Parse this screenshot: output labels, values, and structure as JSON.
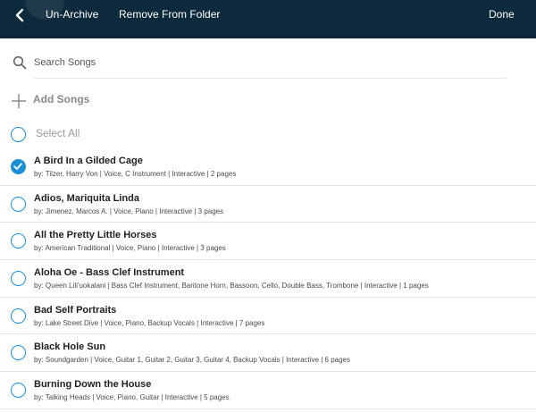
{
  "header": {
    "unarchive_label": "Un-Archive",
    "remove_label": "Remove From Folder",
    "done_label": "Done",
    "bg_color": "#0c2a3b"
  },
  "search": {
    "placeholder": "Search Songs",
    "value": ""
  },
  "add_songs_label": "Add Songs",
  "select_all_label": "Select All",
  "accent_color": "#1a8fd6",
  "songs": [
    {
      "title": "A Bird In a Gilded Cage",
      "meta": "by: Tilzer, Harry Von | Voice, C Instrument | Interactive | 2 pages",
      "checked": true
    },
    {
      "title": "Adios, Mariquita Linda",
      "meta": "by: Jimenez, Marcos A. | Voice, Piano | Interactive | 3 pages",
      "checked": false
    },
    {
      "title": "All the Pretty Little Horses",
      "meta": "by: American Traditional | Voice, Piano | Interactive | 3 pages",
      "checked": false
    },
    {
      "title": "Aloha Oe - Bass Clef Instrument",
      "meta": "by: Queen Lili'uokalani | Bass Clef Instrument, Baritone Horn, Bassoon, Cello, Double Bass, Trombone | Interactive | 1 pages",
      "checked": false
    },
    {
      "title": "Bad Self Portraits",
      "meta": "by: Lake Street Dive | Voice, Piano, Backup Vocals | Interactive | 7 pages",
      "checked": false
    },
    {
      "title": "Black Hole Sun",
      "meta": "by: Soundgarden | Voice, Guitar 1, Guitar 2, Guitar 3, Guitar 4, Backup Vocals | Interactive | 6 pages",
      "checked": false
    },
    {
      "title": "Burning Down the House",
      "meta": "by: Talking Heads | Voice, Piano, Guitar | Interactive | 5 pages",
      "checked": false
    }
  ]
}
